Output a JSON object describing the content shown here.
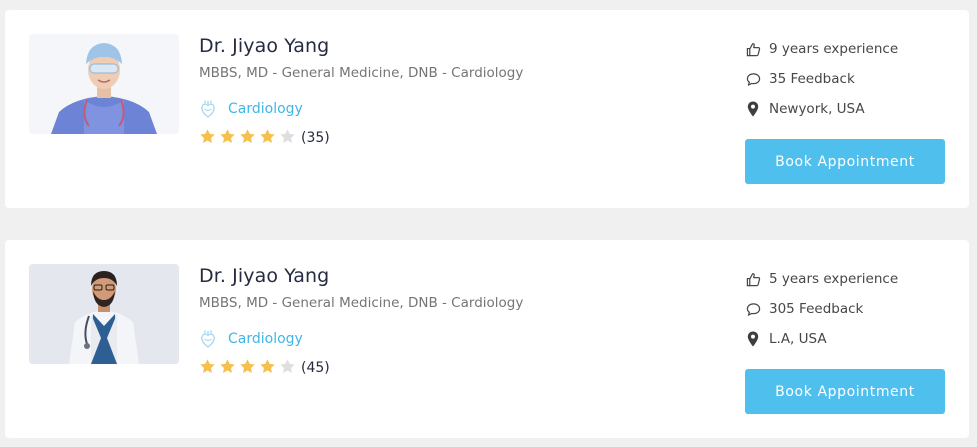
{
  "doctors": [
    {
      "name": "Dr. Jiyao Yang",
      "degree": "MBBS, MD - General Medicine, DNB - Cardiology",
      "specialty": "Cardiology",
      "rating": 4,
      "rating_max": 5,
      "rating_count": "(35)",
      "experience": "9 years experience",
      "feedback": "35 Feedback",
      "location": "Newyork, USA",
      "book_label": "Book Appointment"
    },
    {
      "name": "Dr. Jiyao Yang",
      "degree": "MBBS, MD - General Medicine, DNB - Cardiology",
      "specialty": "Cardiology",
      "rating": 4,
      "rating_max": 5,
      "rating_count": "(45)",
      "experience": "5 years experience",
      "feedback": "305 Feedback",
      "location": "L.A, USA",
      "book_label": "Book Appointment"
    }
  ],
  "colors": {
    "accent": "#4fbfee",
    "specialty": "#3fb6e8",
    "star_filled": "#f4c150",
    "star_empty": "#dedfe0",
    "page_bg": "#f0f0f0"
  },
  "icons": {
    "experience": "thumbs-up-icon",
    "feedback": "comment-icon",
    "location": "map-marker-icon",
    "specialty": "heart-specialty-icon",
    "star": "star-icon"
  }
}
